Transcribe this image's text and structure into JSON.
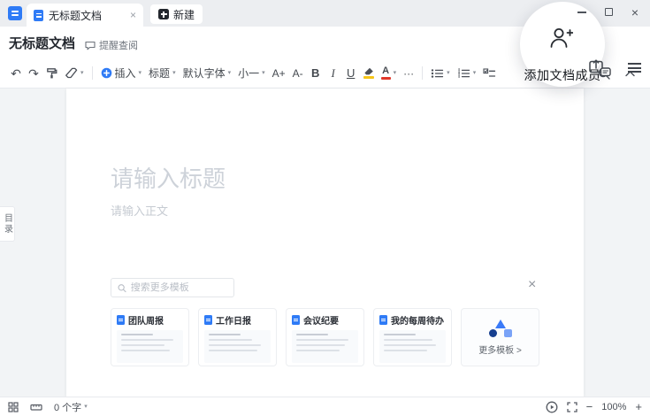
{
  "icons": {
    "caret_down": "▾",
    "undo": "↶",
    "redo": "↷",
    "more": "···",
    "close": "×",
    "minus": "−",
    "plus": "+"
  },
  "tabs": {
    "doc_tab": "无标题文档",
    "new_tab": "新建"
  },
  "header": {
    "title": "无标题文档",
    "remind": "提醒查阅",
    "coach": "添加文档成员"
  },
  "toolbar": {
    "insert": "插入",
    "heading": "标题",
    "font": "默认字体",
    "size": "小一",
    "font_up": "A+",
    "font_down": "A-",
    "bold": "B",
    "italic": "I",
    "underline": "U",
    "color_letter": "A"
  },
  "editor": {
    "title_placeholder": "请输入标题",
    "body_placeholder": "请输入正文",
    "outline": "目录"
  },
  "templates": {
    "search_placeholder": "搜索更多模板",
    "cards": [
      {
        "title": "团队周报"
      },
      {
        "title": "工作日报"
      },
      {
        "title": "会议纪要"
      },
      {
        "title": "我的每周待办"
      }
    ],
    "more": "更多模板 >"
  },
  "statusbar": {
    "word_count": "0 个字",
    "zoom": "100%"
  },
  "colors": {
    "accent": "#2f7bf6",
    "highlight_bar": "#f5c518",
    "font_color_bar": "#e1382a"
  }
}
